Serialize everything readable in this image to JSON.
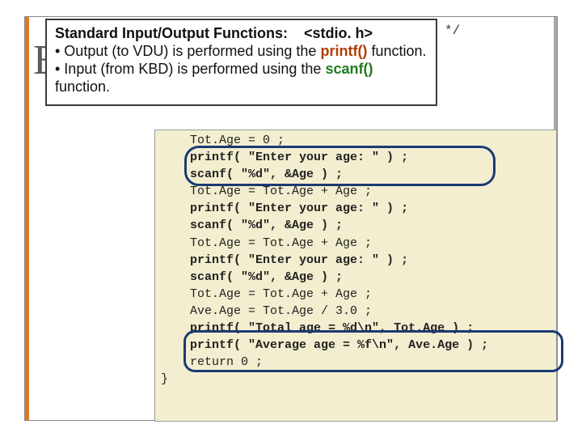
{
  "bg_letter": "E",
  "orphan_comment": "*/",
  "callout": {
    "heading_prefix": "Standard Input/Output Functions:",
    "heading_header": "<stdio. h>",
    "bullet1_pre": "• Output (to VDU) is performed using the ",
    "bullet1_fn": "printf()",
    "bullet1_post": " function.",
    "bullet2_pre": "• Input (from KBD) is performed using the ",
    "bullet2_fn": "scanf()",
    "bullet2_post": " function."
  },
  "code": {
    "l01_indent": "    ",
    "l01": "Tot.Age = 0 ;",
    "l02a": "printf",
    "l02b": "( \"Enter your age: \" ) ;",
    "l03a": "scanf",
    "l03b": "( \"%d\", &Age ) ;",
    "l04": "Tot.Age = Tot.Age + Age ;",
    "l05a": "printf",
    "l05b": "( \"Enter your age: \" ) ;",
    "l06a": "scanf",
    "l06b": "( \"%d\", &Age ) ;",
    "l07": "Tot.Age = Tot.Age + Age ;",
    "l08a": "printf",
    "l08b": "( \"Enter your age: \" ) ;",
    "l09a": "scanf",
    "l09b": "( \"%d\", &Age ) ;",
    "l10": "Tot.Age = Tot.Age + Age ;",
    "l11": "Ave.Age = Tot.Age / 3.0 ;",
    "l12a": "printf",
    "l12b": "( \"Total age = %d\\n\", Tot.Age ) ;",
    "l13a": "printf",
    "l13b": "( \"Average age = %f\\n\", Ave.Age ) ;",
    "l14": "return 0 ;",
    "l15": "}"
  }
}
